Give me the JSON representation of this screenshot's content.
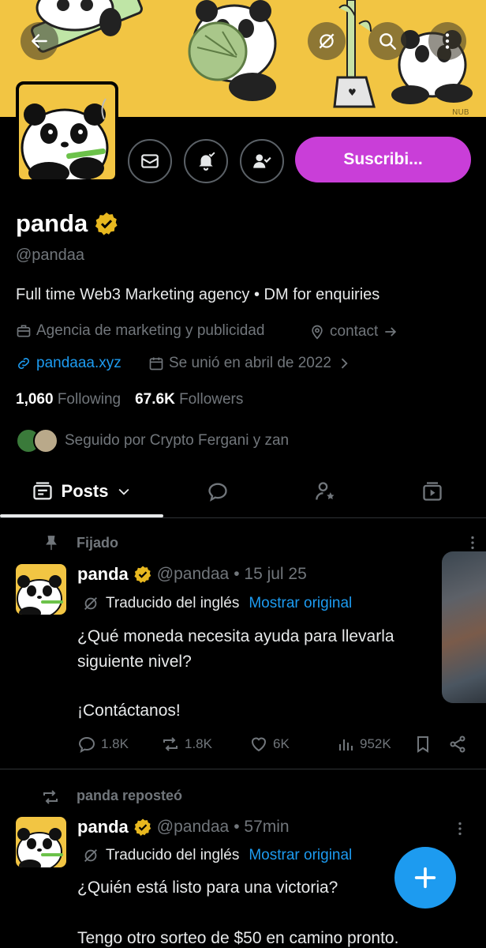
{
  "banner": {
    "watermark": "NUB"
  },
  "profile": {
    "name": "panda",
    "handle": "@pandaa",
    "bio": "Full time Web3 Marketing agency • DM for enquiries",
    "category": "Agencia de marketing y publicidad",
    "location_link": "contact",
    "website": "pandaaa.xyz",
    "joined": "Se unió en abril de 2022",
    "following_count": "1,060",
    "following_label": "Following",
    "followers_count": "67.6K",
    "followers_label": "Followers",
    "followed_by": "Seguido por Crypto Fergani y zan",
    "subscribe_label": "Suscribi..."
  },
  "tabs": {
    "posts_label": "Posts"
  },
  "posts": [
    {
      "context_label": "Fijado",
      "name": "panda",
      "handle": "@pandaa",
      "date": "• 15 jul 25",
      "translated_label": "Traducido del inglés",
      "show_original": "Mostrar original",
      "text_line1": "¿Qué moneda necesita ayuda para llevarla",
      "text_line2": "siguiente nivel?",
      "text_line3": "¡Contáctanos!",
      "replies": "1.8K",
      "reposts": "1.8K",
      "likes": "6K",
      "views": "952K"
    },
    {
      "context_label": "panda reposteó",
      "name": "panda",
      "handle": "@pandaa",
      "date": "• 57min",
      "translated_label": "Traducido del inglés",
      "show_original": "Mostrar original",
      "text_line1": "¿Quién está listo para una victoria? ",
      "text_line2": "Tengo otro sorteo de $50 en camino pronto."
    }
  ],
  "colors": {
    "banner_yellow": "#f2c543",
    "subscribe_purple": "#c93ed8",
    "link_blue": "#1d9bf0",
    "verified_gold": "#e8b81f"
  }
}
